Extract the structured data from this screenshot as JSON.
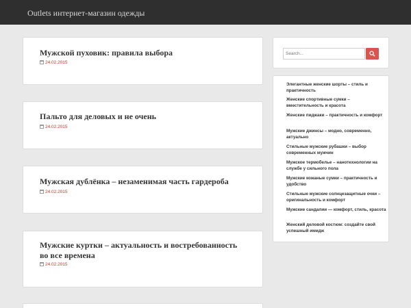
{
  "site": {
    "brand": "Outlets интернет-магазин одежды"
  },
  "posts": [
    {
      "title": "Мужской пуховик: правила выбора",
      "date": "24.02.2015"
    },
    {
      "title": "Пальто для деловых и не очень",
      "date": "24.02.2015"
    },
    {
      "title": "Мужская дублёнка – незаменимая часть гардероба",
      "date": "24.02.2015"
    },
    {
      "title": "Мужские куртки – актуальность и востребованность во все времена",
      "date": "24.02.2015"
    }
  ],
  "sidebar": {
    "search_placeholder": "Search...",
    "links": [
      "Элегантные женские шорты – стиль и практичность",
      "Женские спортивные сумки – вместительность и красота",
      "Женские пиджаки – практичность и комфорт",
      "Мужские джинсы – модно, современно, актуально",
      "Стильные мужские рубашки – выбор современных мужчин",
      "Мужское термобелье – нанотехнологии на службе у сильного пола",
      "Мужские кожаные сумки – практичность и удобство",
      "Стильные мужские солнцезащитные очки – оригинальность и комфорт",
      "Мужские сандалии — комфорт, стиль, красота",
      "Женский деловой костюм: создайте свой успешный имидж"
    ]
  },
  "colors": {
    "header_bg": "#2f2f2f",
    "accent": "#d9534f",
    "date": "#c0392b",
    "page_bg": "#e9e9e9"
  },
  "icons": {
    "date": "calendar-icon",
    "search": "search-icon"
  }
}
